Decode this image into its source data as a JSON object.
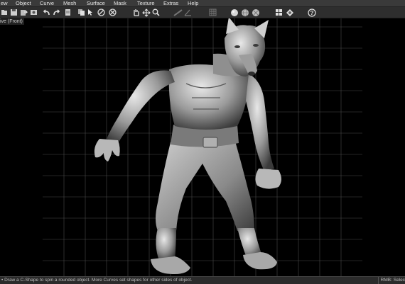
{
  "menu": {
    "items": [
      {
        "label": "ew"
      },
      {
        "label": "Object"
      },
      {
        "label": "Curve"
      },
      {
        "label": "Mesh"
      },
      {
        "label": "Surface"
      },
      {
        "label": "Mask"
      },
      {
        "label": "Texture"
      },
      {
        "label": "Extras"
      },
      {
        "label": "Help"
      }
    ]
  },
  "toolbar": {
    "icons": [
      "open-file-icon",
      "save-file-icon",
      "export-icon",
      "snapshot-icon",
      "undo-icon",
      "redo-icon",
      "document-icon",
      "copy-icon",
      "select-arrow-icon",
      "delete-icon",
      "cancel-icon",
      "ruler-icon",
      "angle-icon",
      "grid-icon",
      "hand-pan-icon",
      "move-arrows-icon",
      "zoom-icon",
      "sphere-smooth-icon",
      "sphere-grid-icon",
      "sphere-cross-icon",
      "view-grid-icon",
      "navigate-diamond-icon",
      "help-icon"
    ]
  },
  "viewport": {
    "label": "ive (Front)"
  },
  "status": {
    "tip": "• Draw a C-Shape to spin a rounded object. More Curves set shapes for other sides of object.",
    "mode": "RMB: Selec"
  }
}
